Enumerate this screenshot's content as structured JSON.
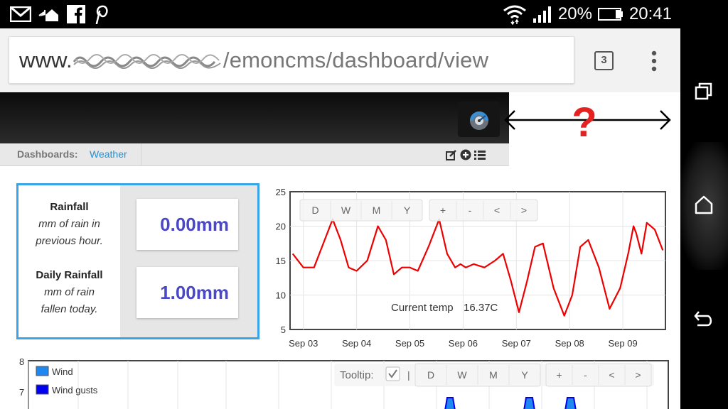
{
  "status_bar": {
    "left_icons": [
      "gmail-icon",
      "home-share-icon",
      "facebook-icon",
      "pinterest-icon"
    ],
    "right_icons": [
      "wifi-icon",
      "signal-icon",
      "battery-icon"
    ],
    "battery_percent": "20%",
    "clock": "20:41"
  },
  "browser": {
    "url_prefix": "www.",
    "url_path": "/emoncms/dashboard/view",
    "tab_count": "3"
  },
  "nav_bar": {
    "buttons": [
      "recent-apps",
      "home",
      "back"
    ]
  },
  "annotation": {
    "mark": "?",
    "color": "#e52222"
  },
  "subnav": {
    "label": "Dashboards:",
    "active_dashboard": "Weather"
  },
  "rain": {
    "items": [
      {
        "title": "Rainfall",
        "desc1": "mm of rain in",
        "desc2": "previous hour.",
        "value": "0.00mm"
      },
      {
        "title": "Daily Rainfall",
        "desc1": "mm of rain",
        "desc2": "fallen today.",
        "value": "1.00mm"
      }
    ],
    "accent": "#3aa4e8",
    "value_color": "#4a48c8"
  },
  "temp_chart": {
    "buttons": [
      "D",
      "W",
      "M",
      "Y",
      "+",
      "-",
      "<",
      ">"
    ],
    "status_label": "Current temp",
    "status_value": "16.37C"
  },
  "wind_chart": {
    "toolbar": {
      "tooltip_label": "Tooltip:",
      "separator": "|",
      "buttons": [
        "D",
        "W",
        "M",
        "Y",
        "+",
        "-",
        "<",
        ">"
      ]
    }
  },
  "chart_data": [
    {
      "type": "line",
      "ylim": [
        5,
        25
      ],
      "yticks": [
        "5",
        "10",
        "15",
        "20",
        "25"
      ],
      "xticks": [
        "Sep 03",
        "Sep 04",
        "Sep 05",
        "Sep 06",
        "Sep 07",
        "Sep 08",
        "Sep 09"
      ],
      "color": "#ee0000",
      "series": [
        {
          "x": [
            2.8,
            3.0,
            3.2,
            3.4,
            3.55,
            3.7,
            3.85,
            4.0,
            4.2,
            4.4,
            4.55,
            4.7,
            4.85,
            5.0,
            5.15,
            5.35,
            5.55,
            5.7,
            5.85,
            5.95,
            6.05,
            6.2,
            6.4,
            6.6,
            6.75,
            6.9,
            7.05,
            7.2,
            7.35,
            7.5,
            7.7,
            7.9,
            8.05,
            8.2,
            8.35,
            8.55,
            8.75,
            8.95,
            9.1,
            9.2,
            9.25,
            9.35,
            9.45,
            9.6,
            9.75
          ],
          "y": [
            16,
            14,
            14,
            18,
            21,
            18,
            14,
            13.5,
            15,
            20,
            18,
            13,
            14,
            14,
            13.5,
            17,
            21,
            16,
            14,
            14.5,
            14,
            14.5,
            14,
            15,
            16,
            12,
            7.5,
            12,
            17,
            17.5,
            11,
            7,
            10,
            17,
            18,
            14,
            8,
            11,
            16,
            20,
            19,
            16,
            20.5,
            19.5,
            16.5
          ]
        }
      ]
    },
    {
      "type": "area",
      "ylim": [
        6,
        8
      ],
      "yticks": [
        "8",
        "7"
      ],
      "legend": "top-left",
      "series": [
        {
          "name": "Wind",
          "color": "#1e88f0"
        },
        {
          "name": "Wind gusts",
          "color": "#0000ee"
        }
      ]
    }
  ]
}
